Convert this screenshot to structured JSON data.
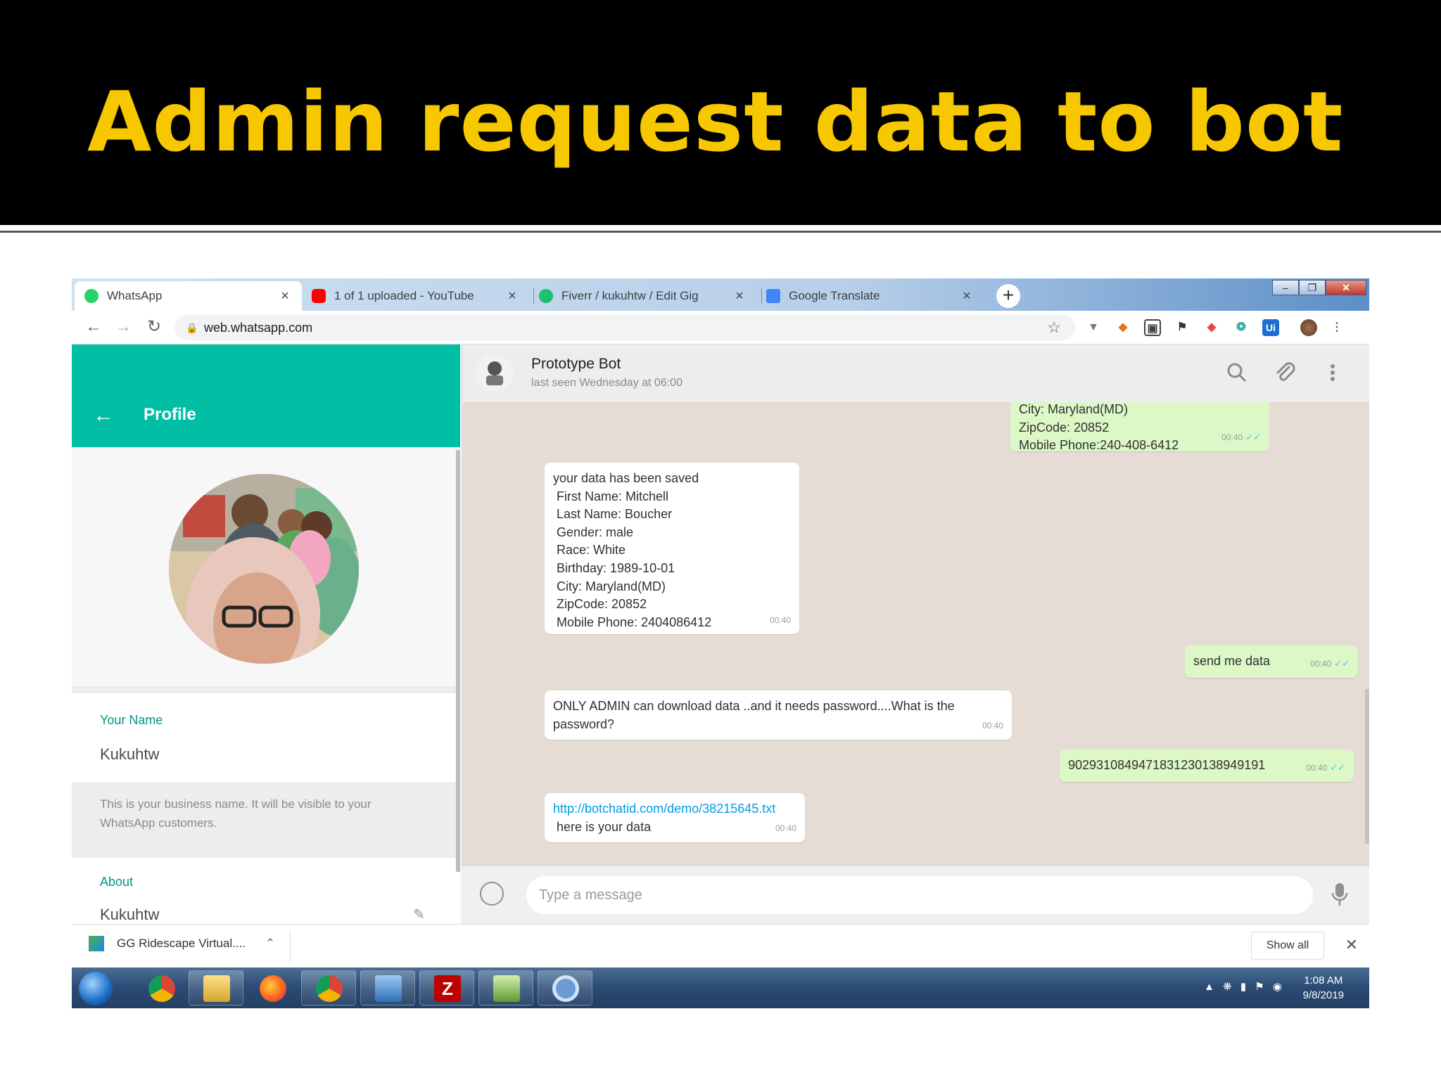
{
  "slide": {
    "title": "Admin request data to bot"
  },
  "browser": {
    "tabs": [
      {
        "title": "WhatsApp",
        "favicon": "whatsapp-icon"
      },
      {
        "title": "1 of 1 uploaded - YouTube",
        "favicon": "youtube-icon"
      },
      {
        "title": "Fiverr / kukuhtw / Edit Gig",
        "favicon": "fiverr-icon"
      },
      {
        "title": "Google Translate",
        "favicon": "google-translate-icon"
      }
    ],
    "url": "web.whatsapp.com"
  },
  "profile": {
    "header": "Profile",
    "name_label": "Your Name",
    "name": "Kukuhtw",
    "name_hint": "This is your business name. It will be visible to your WhatsApp customers.",
    "about_label": "About",
    "about": "Kukuhtw"
  },
  "chat": {
    "contact": "Prototype Bot",
    "status": "last seen Wednesday at 06:00",
    "messages": [
      {
        "dir": "out",
        "text": "City: Maryland(MD)\nZipCode: 20852\nMobile Phone:240-408-6412",
        "time": "00:40"
      },
      {
        "dir": "in",
        "text": "your data has been saved\n First Name: Mitchell\n Last Name: Boucher\n Gender: male\n Race: White\n Birthday: 1989-10-01\n City: Maryland(MD)\n ZipCode: 20852\n Mobile Phone: 2404086412",
        "time": "00:40"
      },
      {
        "dir": "out",
        "text": "send me data",
        "time": "00:40"
      },
      {
        "dir": "in",
        "text": "ONLY ADMIN can download data ..and it needs password....What is the\npassword?",
        "time": "00:40"
      },
      {
        "dir": "out",
        "text": "90293108494718312301389491​91",
        "time": "00:40"
      },
      {
        "dir": "in",
        "link": "http://botchatid.com/demo/38215645.txt",
        "text": " here is your data",
        "time": "00:40"
      }
    ],
    "input_placeholder": "Type a message"
  },
  "downloads": {
    "item": "GG Ridescape Virtual....",
    "show_all": "Show all"
  },
  "taskbar": {
    "time": "1:08 AM",
    "date": "9/8/2019"
  },
  "colors": {
    "whatsapp_green": "#00bfa5",
    "incoming": "#ffffff",
    "outgoing": "#dcf8c6",
    "title": "#f7c800"
  }
}
